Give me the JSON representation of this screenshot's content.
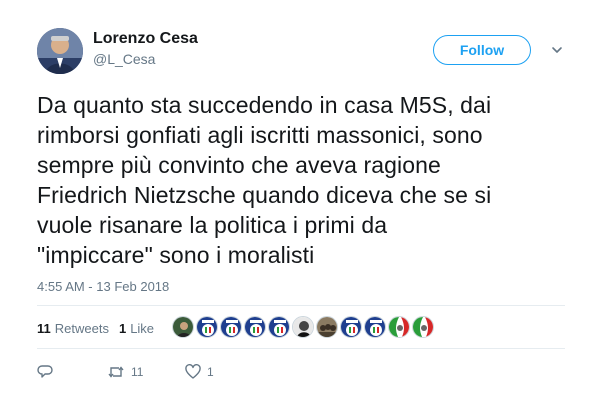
{
  "author": {
    "name": "Lorenzo Cesa",
    "handle": "@L_Cesa"
  },
  "follow_button": {
    "label": "Follow"
  },
  "tweet": {
    "lines": [
      "Da quanto sta succedendo in casa M5S, dai",
      "rimborsi gonfiati agli iscritti massonici, sono",
      "sempre più convinto che aveva ragione",
      "Friedrich Nietzsche quando diceva che se si",
      "vuole risanare la politica i primi da",
      "\"impiccare\" sono i moralisti"
    ],
    "timestamp": "4:55 AM - 13 Feb 2018"
  },
  "stats": {
    "retweets_count": "11",
    "retweets_label": "Retweets",
    "likes_count": "1",
    "likes_label": "Like"
  },
  "likers": [
    {
      "icon": "profile-avatar-green"
    },
    {
      "icon": "party-logo-avatar"
    },
    {
      "icon": "party-logo-avatar"
    },
    {
      "icon": "party-logo-avatar"
    },
    {
      "icon": "party-logo-avatar"
    },
    {
      "icon": "profile-avatar-bw"
    },
    {
      "icon": "profile-avatar-group"
    },
    {
      "icon": "party-logo-avatar"
    },
    {
      "icon": "party-logo-avatar"
    },
    {
      "icon": "italy-flag-avatar"
    },
    {
      "icon": "italy-flag-avatar"
    }
  ],
  "actions": {
    "reply_count": "",
    "retweet_count": "11",
    "like_count": "1"
  },
  "colors": {
    "accent": "#1da1f2",
    "text": "#14171a",
    "muted": "#657786",
    "divider": "#e6ecf0"
  }
}
